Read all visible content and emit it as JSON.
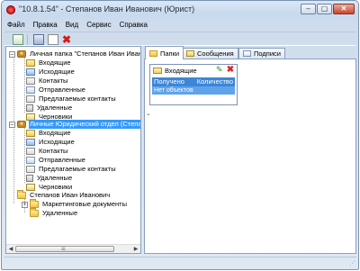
{
  "window": {
    "title": "\"10.8.1.54\" - Степанов Иван Иванович (Юрист)",
    "controls": {
      "minimize": "–",
      "maximize": "▢",
      "close": "✕"
    }
  },
  "menu": [
    "Файл",
    "Правка",
    "Вид",
    "Сервис",
    "Справка"
  ],
  "toolbar": {
    "icons": [
      "new-icon",
      "save-icon",
      "document-icon",
      "delete-icon"
    ]
  },
  "tree": {
    "groups": [
      {
        "label": "Личная папка \"Степанов Иван Иванович\"",
        "items": [
          "Входящие",
          "Исходящие",
          "Контакты",
          "Отправленные",
          "Предлагаемые контакты",
          "Удаленные",
          "Черновики"
        ]
      },
      {
        "label": "Личные Юридический отдел (Степанов",
        "items": [
          "Входящие",
          "Исходящие",
          "Контакты",
          "Отправленные",
          "Предлагаемые контакты",
          "Удаленные",
          "Черновики"
        ]
      },
      {
        "label": "Степанов Иван Иванович",
        "items": [
          "Маркетинговые документы",
          "Удаленные"
        ]
      }
    ]
  },
  "tabs": [
    "Папки",
    "Сообщения",
    "Подписи"
  ],
  "folder_card": {
    "title": "Входящие",
    "columns": [
      "Получено",
      "Количество"
    ],
    "empty_text": "Нет объектов"
  },
  "colors": {
    "selection": "#3399ff",
    "header_blue": "#3d86d6"
  }
}
